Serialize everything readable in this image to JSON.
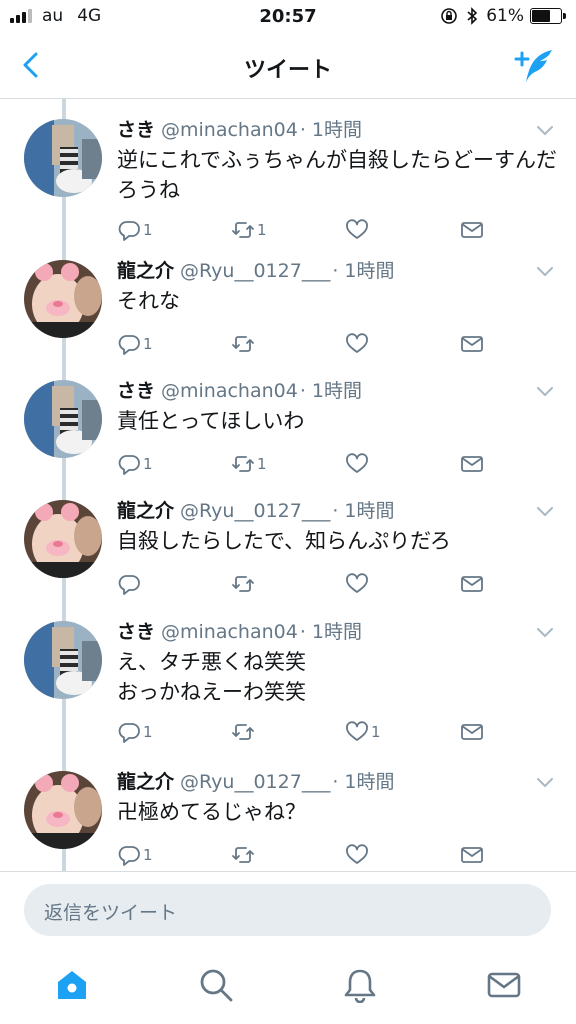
{
  "status": {
    "carrier": "au",
    "network": "4G",
    "time": "20:57",
    "battery": "61%",
    "battery_level": 0.61
  },
  "nav": {
    "title": "ツイート",
    "back_icon": "chevron-left-icon",
    "compose_icon": "compose-tweet-icon"
  },
  "colors": {
    "accent": "#1da1f2",
    "muted": "#657786",
    "thread_line": "#ccd6dd"
  },
  "tweets": [
    {
      "name": "さき",
      "handle": "@minachan04",
      "time": "· 1時間",
      "text": "逆にこれでふぅちゃんが自殺したらどーすんだろうね",
      "replies": "1",
      "retweets": "1",
      "likes": ""
    },
    {
      "name": "龍之介",
      "handle": "@Ryu__0127___",
      "time": "· 1時間",
      "text": "それな",
      "replies": "1",
      "retweets": "",
      "likes": ""
    },
    {
      "name": "さき",
      "handle": "@minachan04",
      "time": "· 1時間",
      "text": "責任とってほしいわ",
      "replies": "1",
      "retweets": "1",
      "likes": ""
    },
    {
      "name": "龍之介",
      "handle": "@Ryu__0127___",
      "time": "· 1時間",
      "text": "自殺したらしたで、知らんぷりだろ",
      "replies": "",
      "retweets": "",
      "likes": ""
    },
    {
      "name": "さき",
      "handle": "@minachan04",
      "time": "· 1時間",
      "text": "え、タチ悪くね笑笑\nおっかねえーわ笑笑",
      "replies": "1",
      "retweets": "",
      "likes": "1"
    },
    {
      "name": "龍之介",
      "handle": "@Ryu__0127___",
      "time": "· 1時間",
      "text": "卍極めてるじゃね？",
      "replies": "1",
      "retweets": "",
      "likes": ""
    }
  ],
  "reply": {
    "placeholder": "返信をツイート"
  },
  "tabs": [
    "home-icon",
    "search-icon",
    "notifications-icon",
    "messages-icon"
  ]
}
